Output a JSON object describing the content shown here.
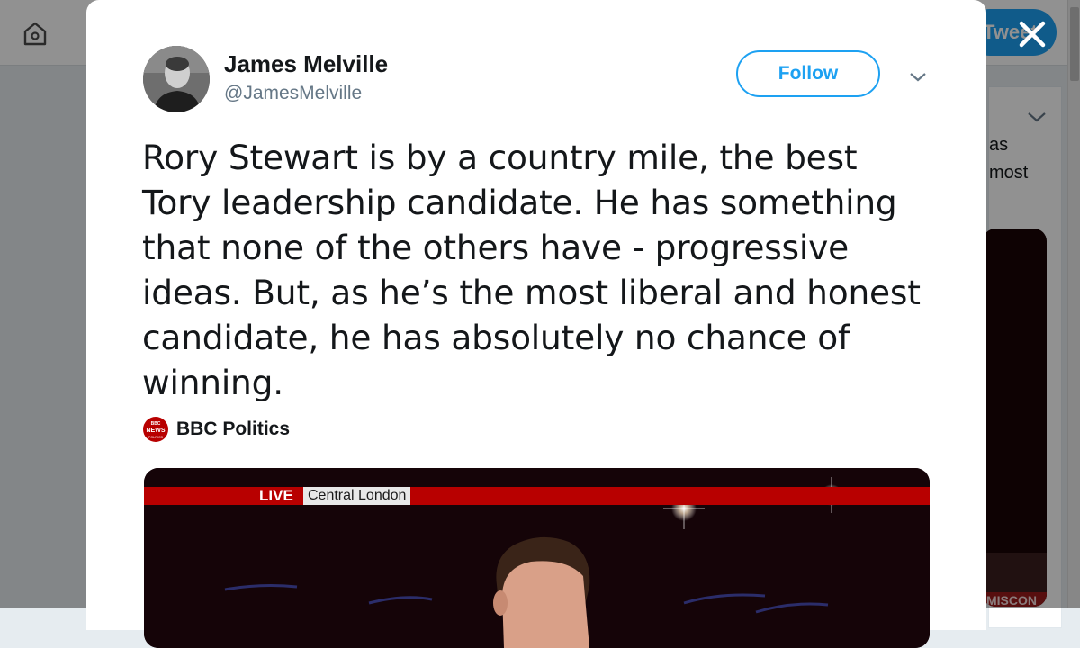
{
  "background": {
    "tweet_button_label": "Tweet",
    "side_text": [
      "as",
      "most"
    ],
    "side_banner": "MISCON"
  },
  "tweet": {
    "author": {
      "display_name": "James Melville",
      "screen_name": "@JamesMelville"
    },
    "follow_label": "Follow",
    "text_lines": [
      "Rory Stewart is by a country mile, the best",
      "Tory leadership candidate. He has something",
      "that none of the others have - progressive",
      "ideas. But, as he’s the most liberal and honest",
      "candidate, he has absolutely no chance of",
      "winning."
    ],
    "media_source": {
      "name": "BBC Politics",
      "logo_text": [
        "BBC",
        "NEWS",
        "POLITICS"
      ]
    },
    "video": {
      "live_label": "LIVE",
      "location": "Central London"
    }
  },
  "colors": {
    "accent": "#1da1f2",
    "text": "#14171a",
    "secondary_text": "#657786",
    "bbc_red": "#b80000"
  }
}
